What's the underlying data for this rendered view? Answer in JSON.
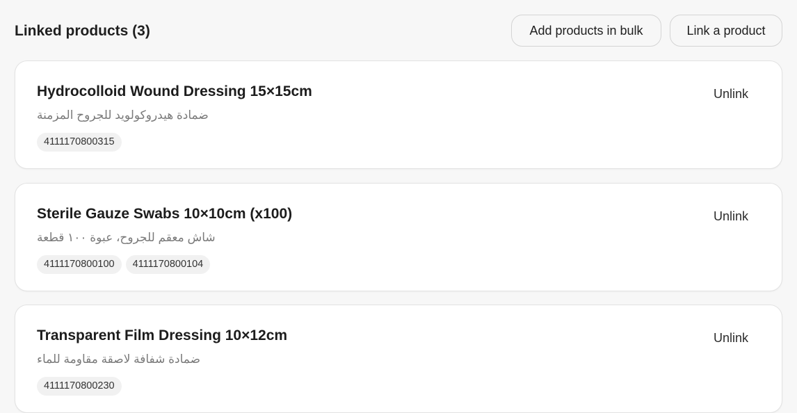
{
  "header": {
    "title": "Linked products (3)",
    "bulk_button_label": "Add products in bulk",
    "link_button_label": "Link a product"
  },
  "products": [
    {
      "title": "Hydrocolloid Wound Dressing 15×15cm",
      "subtitle": "ضمادة هيدروكولويد للجروح المزمنة",
      "codes": [
        "4111170800315"
      ],
      "action_label": "Unlink"
    },
    {
      "title": "Sterile Gauze Swabs 10×10cm (x100)",
      "subtitle": "شاش معقم للجروح، عبوة ١٠٠ قطعة",
      "codes": [
        "4111170800100",
        "4111170800104"
      ],
      "action_label": "Unlink"
    },
    {
      "title": "Transparent Film Dressing 10×12cm",
      "subtitle": "ضمادة شفافة لاصقة مقاومة للماء",
      "codes": [
        "4111170800230"
      ],
      "action_label": "Unlink"
    }
  ]
}
